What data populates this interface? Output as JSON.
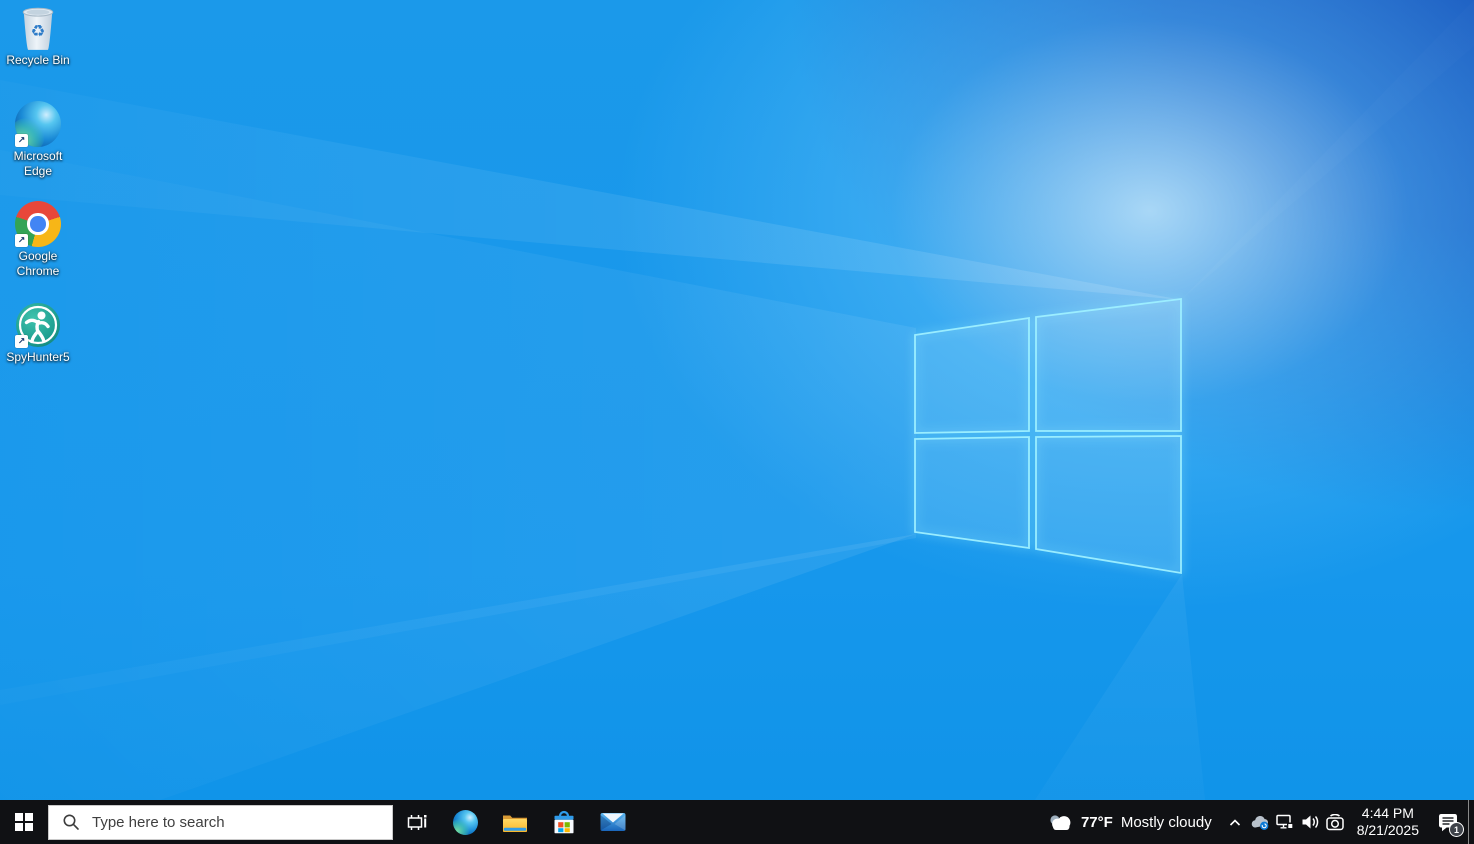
{
  "desktop": {
    "icons": {
      "recycle_bin": {
        "label": "Recycle Bin"
      },
      "edge": {
        "line1": "Microsoft",
        "line2": "Edge"
      },
      "chrome": {
        "line1": "Google",
        "line2": "Chrome"
      },
      "spyhunter": {
        "label": "SpyHunter5"
      }
    }
  },
  "taskbar": {
    "search": {
      "placeholder": "Type here to search"
    },
    "tray": {
      "weather": {
        "temperature": "77°F",
        "condition": "Mostly cloudy"
      },
      "clock": {
        "time": "4:44 PM",
        "date": "8/21/2025"
      },
      "notifications": {
        "badge_count": "1"
      }
    }
  },
  "icons": {
    "shortcut_arrow_glyph": "↗",
    "recycle_glyph": "♻",
    "desktop": [
      "recycle-bin-icon",
      "microsoft-edge-icon",
      "google-chrome-icon",
      "spyhunter5-icon"
    ],
    "taskbar": [
      "start-icon",
      "search-icon",
      "task-view-icon",
      "edge-icon",
      "file-explorer-icon",
      "microsoft-store-icon",
      "mail-icon"
    ],
    "tray": [
      "weather-cloud-icon",
      "chevron-up-icon",
      "onedrive-icon",
      "network-icon",
      "volume-icon",
      "meet-now-icon",
      "action-center-icon"
    ]
  },
  "colors": {
    "wallpaper_azure": "#1797ec",
    "wallpaper_glow": "#cdeffe",
    "wallpaper_corner_dark": "#1250ba",
    "logo_edge_glow": "#9ef0ff",
    "taskbar_background": "#101114",
    "tray_text": "#ffffff",
    "search_box_background": "#ffffff",
    "search_placeholder_text": "#3f3f3f"
  }
}
